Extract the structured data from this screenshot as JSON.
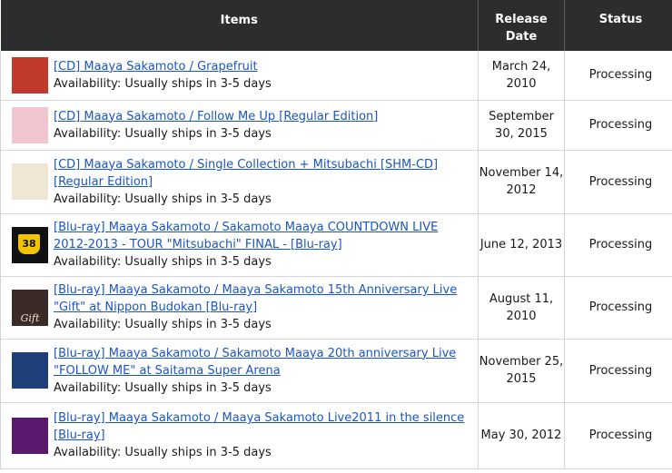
{
  "table": {
    "headers": {
      "items": "Items",
      "release_date": "Release Date",
      "status": "Status"
    }
  },
  "rows": [
    {
      "title": "[CD] Maaya Sakamoto / Grapefruit",
      "availability": "Availability: Usually ships in 3-5 days",
      "release_date": "March 24, 2010",
      "status": "Processing",
      "thumb_icon": "album-cover-icon",
      "thumb_color": "#c0392b"
    },
    {
      "title": "[CD] Maaya Sakamoto / Follow Me Up [Regular Edition]",
      "availability": "Availability: Usually ships in 3-5 days",
      "release_date": "September 30, 2015",
      "status": "Processing",
      "thumb_icon": "album-cover-icon",
      "thumb_color": "#f2c6d0"
    },
    {
      "title": "[CD] Maaya Sakamoto / Single Collection + Mitsubachi [SHM-CD] [Regular Edition]",
      "availability": "Availability: Usually ships in 3-5 days",
      "release_date": "November 14, 2012",
      "status": "Processing",
      "thumb_icon": "album-cover-icon",
      "thumb_color": "#efe6d4"
    },
    {
      "title": "[Blu-ray] Maaya Sakamoto / Sakamoto Maaya COUNTDOWN LIVE 2012-2013 - TOUR \"Mitsubachi\" FINAL - [Blu-ray]",
      "availability": "Availability: Usually ships in 3-5 days",
      "release_date": "June 12, 2013",
      "status": "Processing",
      "thumb_icon": "route-38-cover-icon",
      "thumb_color": "#111111",
      "thumb_text": "38"
    },
    {
      "title": "[Blu-ray] Maaya Sakamoto / Maaya Sakamoto 15th Anniversary Live \"Gift\" at Nippon Budokan [Blu-ray]",
      "availability": "Availability: Usually ships in 3-5 days",
      "release_date": "August 11, 2010",
      "status": "Processing",
      "thumb_icon": "album-cover-icon",
      "thumb_color": "#3a2a28",
      "thumb_text": "Gift"
    },
    {
      "title": "[Blu-ray] Maaya Sakamoto / Sakamoto Maaya 20th anniversary Live \"FOLLOW ME\" at Saitama Super Arena",
      "availability": "Availability: Usually ships in 3-5 days",
      "release_date": "November 25, 2015",
      "status": "Processing",
      "thumb_icon": "album-cover-icon",
      "thumb_color": "#1f3f7a"
    },
    {
      "title": "[Blu-ray] Maaya Sakamoto / Maaya Sakamoto Live2011 in the silence [Blu-ray]",
      "availability": "Availability: Usually ships in 3-5 days",
      "release_date": "May 30, 2012",
      "status": "Processing",
      "thumb_icon": "album-cover-icon",
      "thumb_color": "#5a1a6e"
    }
  ]
}
